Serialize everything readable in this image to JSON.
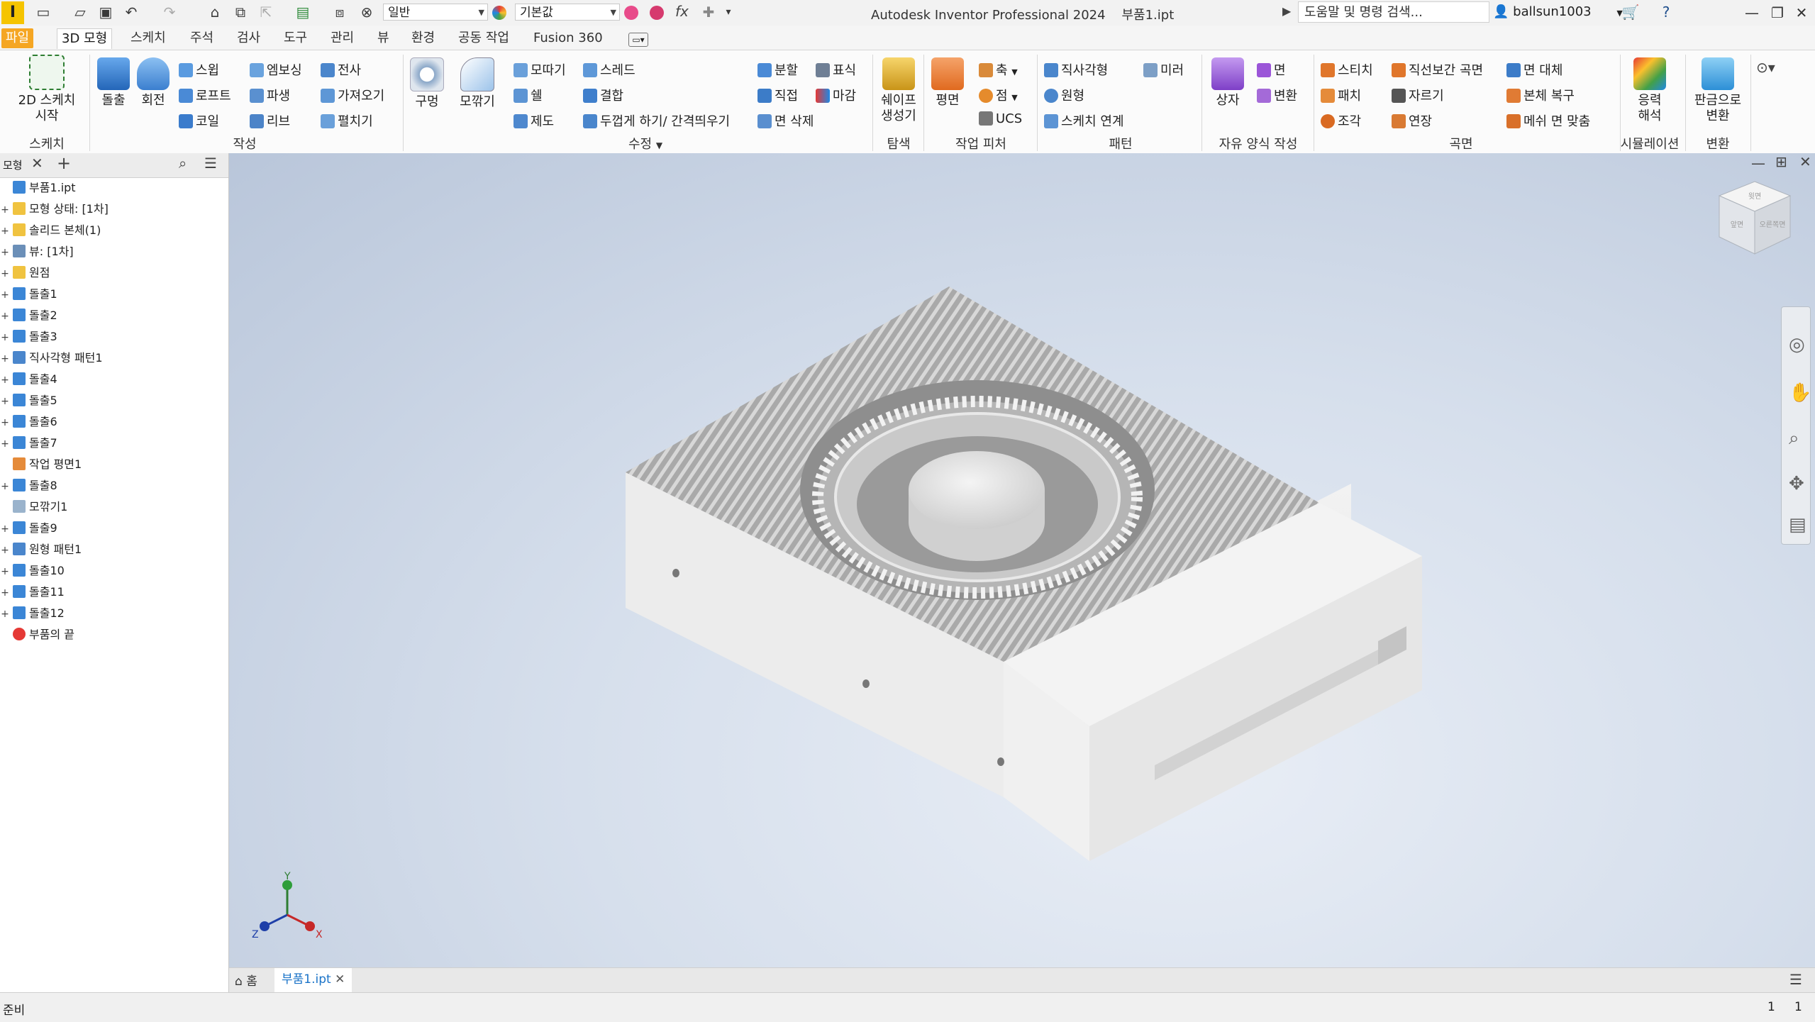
{
  "titlebar": {
    "app_letter": "I",
    "appearance": "일반",
    "material": "기본값",
    "fx": "fx",
    "app_title": "Autodesk Inventor Professional 2024",
    "doc_title": "부품1.ipt",
    "search_placeholder": "도움말 및 명령 검색...",
    "user": "ballsun1003"
  },
  "menu_tabs": [
    "파일",
    "3D 모형",
    "스케치",
    "주석",
    "검사",
    "도구",
    "관리",
    "뷰",
    "환경",
    "공동 작업",
    "Fusion 360"
  ],
  "ribbon": {
    "sketch": {
      "big": "2D 스케치\n시작",
      "group": "스케치"
    },
    "create": {
      "big": [
        "돌출",
        "회전"
      ],
      "col1": [
        "스윕",
        "로프트",
        "코일"
      ],
      "col2": [
        "엠보싱",
        "파생",
        "리브"
      ],
      "col3": [
        "전사",
        "가져오기",
        "펼치기"
      ],
      "group": "작성"
    },
    "modify": {
      "big": [
        "구멍",
        "모깎기"
      ],
      "col1": [
        "모따기",
        "쉘",
        "제도"
      ],
      "col2": [
        "스레드",
        "결합",
        "두껍게 하기/ 간격띄우기"
      ],
      "col3": [
        "분할",
        "직접",
        "면 삭제"
      ],
      "col4": [
        "표식",
        "마감"
      ],
      "group": "수정"
    },
    "explore": {
      "big": "쉐이프\n생성기",
      "group": "탐색"
    },
    "work": {
      "big": "평면",
      "col": [
        "축",
        "점",
        "UCS"
      ],
      "group": "작업 피처"
    },
    "pattern": {
      "col": [
        "직사각형",
        "원형",
        "스케치 연계"
      ],
      "col2": [
        "미러"
      ],
      "group": "패턴"
    },
    "freeform": {
      "big": "상자",
      "col": [
        "면",
        "변환"
      ],
      "group": "자유 양식 작성"
    },
    "surface": {
      "col1": [
        "스티치",
        "패치",
        "조각"
      ],
      "col2": [
        "직선보간 곡면",
        "자르기",
        "연장"
      ],
      "col3": [
        "면 대체",
        "본체 복구",
        "메쉬 면 맞춤"
      ],
      "group": "곡면"
    },
    "sim": {
      "big": "응력\n해석",
      "group": "시뮬레이션"
    },
    "convert": {
      "big": "판금으로\n변환",
      "group": "변환"
    }
  },
  "browser": {
    "tab": "모형",
    "items": [
      {
        "label": "부품1.ipt",
        "icon": "part"
      },
      {
        "label": "모형 상태: [1차]",
        "icon": "folder"
      },
      {
        "label": "솔리드 본체(1)",
        "icon": "folder"
      },
      {
        "label": "뷰: [1차]",
        "icon": "view"
      },
      {
        "label": "원점",
        "icon": "folder"
      },
      {
        "label": "돌출1",
        "icon": "extrude"
      },
      {
        "label": "돌출2",
        "icon": "extrude"
      },
      {
        "label": "돌출3",
        "icon": "extrude"
      },
      {
        "label": "직사각형 패턴1",
        "icon": "pattern"
      },
      {
        "label": "돌출4",
        "icon": "extrude"
      },
      {
        "label": "돌출5",
        "icon": "extrude"
      },
      {
        "label": "돌출6",
        "icon": "extrude"
      },
      {
        "label": "돌출7",
        "icon": "extrude"
      },
      {
        "label": "작업 평면1",
        "icon": "plane"
      },
      {
        "label": "돌출8",
        "icon": "extrude"
      },
      {
        "label": "모깎기1",
        "icon": "fillet"
      },
      {
        "label": "돌출9",
        "icon": "extrude"
      },
      {
        "label": "원형 패턴1",
        "icon": "circpattern"
      },
      {
        "label": "돌출10",
        "icon": "extrude"
      },
      {
        "label": "돌출11",
        "icon": "extrude"
      },
      {
        "label": "돌출12",
        "icon": "extrude"
      },
      {
        "label": "부품의 끝",
        "icon": "end"
      }
    ]
  },
  "viewcube": {
    "face_top": "윗면",
    "face_left": "앞면",
    "face_right": "오른쪽면"
  },
  "axes": {
    "x": "X",
    "y": "Y",
    "z": "Z"
  },
  "doc_tabs": {
    "home": "홈",
    "doc": "부품1.ipt"
  },
  "status": {
    "text": "준비",
    "count1": "1",
    "count2": "1"
  },
  "colors": {
    "file_tab": "#f5a623",
    "extrude_icon": "#3b86d6",
    "model_gray": "#cfcfcf",
    "active_tab_text": "#1a73c8"
  }
}
